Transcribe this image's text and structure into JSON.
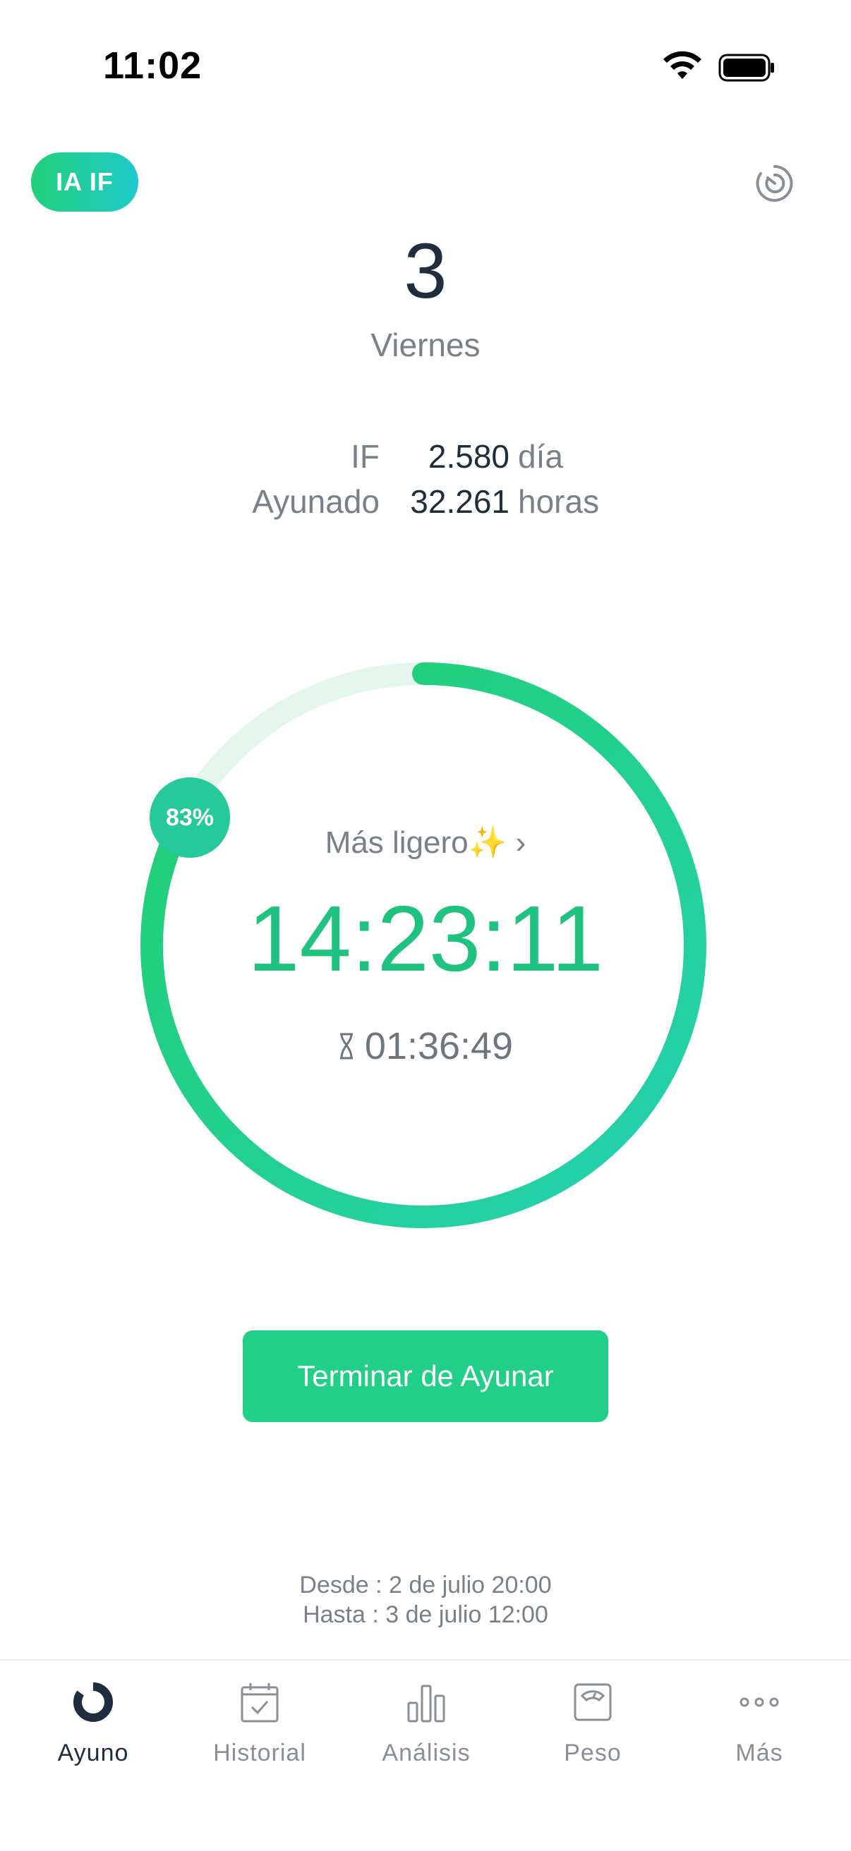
{
  "status_bar": {
    "time": "11:02"
  },
  "header": {
    "ai_badge": "IA IF",
    "history_icon": "timer-history-icon"
  },
  "day": {
    "number": "3",
    "name": "Viernes"
  },
  "stats": [
    {
      "label": "IF",
      "value": "2.580",
      "unit": "día"
    },
    {
      "label": "Ayunado",
      "value": "32.261",
      "unit": "horas"
    }
  ],
  "timer": {
    "progress_percent": 83,
    "progress_label": "83%",
    "stage_link": "Más ligero✨ ›",
    "elapsed": "14:23:11",
    "remaining": "01:36:49",
    "colors": {
      "track": "#e3f6ec",
      "start": "#25d0b0",
      "end": "#20cf6e"
    }
  },
  "cta": {
    "end_fast": "Terminar de Ayunar"
  },
  "range": {
    "from": "Desde : 2 de julio 20:00",
    "to": "Hasta : 3 de julio 12:00"
  },
  "tabs": [
    {
      "label": "Ayuno",
      "icon": "fasting-ring-icon",
      "active": true
    },
    {
      "label": "Historial",
      "icon": "calendar-check-icon",
      "active": false
    },
    {
      "label": "Análisis",
      "icon": "bar-chart-icon",
      "active": false
    },
    {
      "label": "Peso",
      "icon": "scale-icon",
      "active": false
    },
    {
      "label": "Más",
      "icon": "more-dots-icon",
      "active": false
    }
  ]
}
